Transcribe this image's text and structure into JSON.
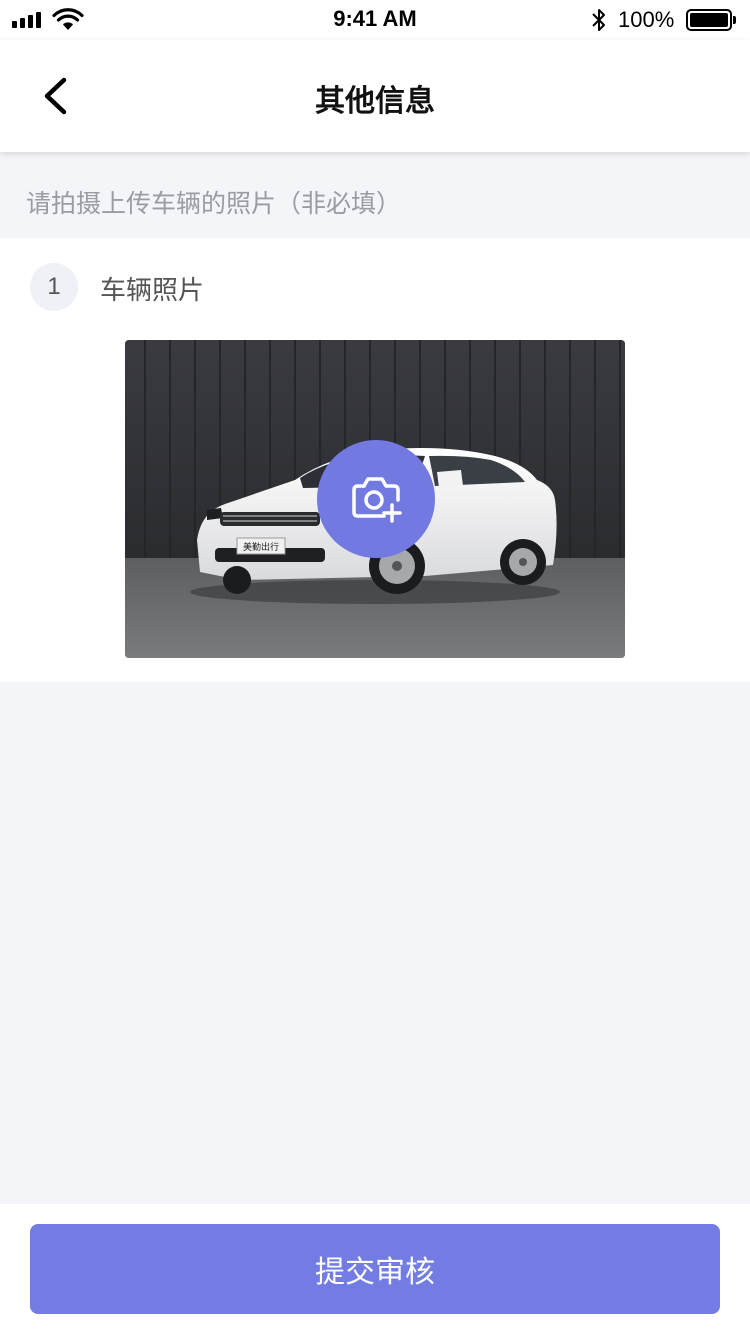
{
  "status_bar": {
    "time": "9:41 AM",
    "battery_level": "100%"
  },
  "nav": {
    "title": "其他信息",
    "back_icon": "chevron-left-icon"
  },
  "hint": {
    "text": "请拍摄上传车辆的照片（非必填）"
  },
  "photo_section": {
    "step_number": "1",
    "label": "车辆照片",
    "plate_text": "美勤出行",
    "camera_icon": "camera-plus-icon"
  },
  "footer": {
    "submit_label": "提交审核"
  },
  "colors": {
    "accent": "#737ce2",
    "page_background": "#f4f5f9",
    "hint_text": "#9a9ca4"
  }
}
